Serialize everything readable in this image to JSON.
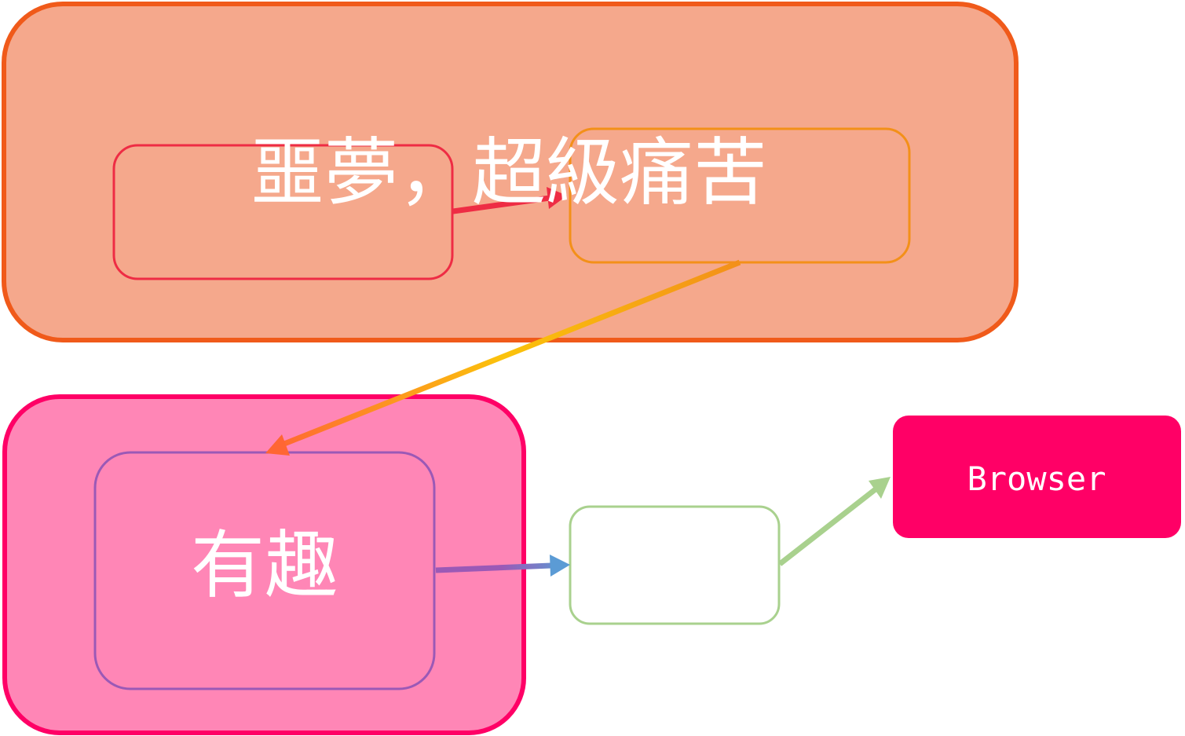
{
  "diagram": {
    "top_group": {
      "label": "噩夢，超級痛苦",
      "fill": "#F5A88C",
      "stroke": "#F05A1A"
    },
    "top_left_box": {
      "stroke": "#EE2C44"
    },
    "top_right_box": {
      "stroke": "#F39019"
    },
    "bottom_group": {
      "label": "有趣",
      "fill": "#FF86B6",
      "stroke": "#FF0066",
      "inner_stroke": "#9B59B6"
    },
    "empty_box": {
      "stroke": "#A9D18E"
    },
    "browser_box": {
      "label": "Browser",
      "fill": "#FF0066"
    },
    "arrows": {
      "red": "#EE2C44",
      "orange_start": "#F39019",
      "orange_mid": "#FBC30B",
      "orange_end": "#FF6633",
      "purple": "#9B59B6",
      "blue": "#5B9BD5",
      "green": "#A9D18E"
    }
  }
}
